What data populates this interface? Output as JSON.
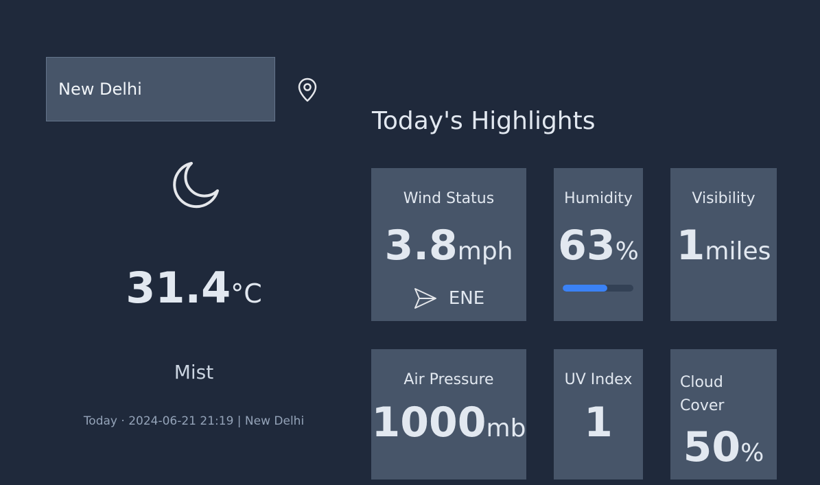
{
  "search": {
    "value": "New Delhi"
  },
  "current": {
    "icon": "moon-icon",
    "temperature": "31.4",
    "unit": "°C",
    "condition": "Mist",
    "footer": "Today · 2024-06-21 21:19 | New Delhi"
  },
  "highlights": {
    "title": "Today's Highlights",
    "wind": {
      "title": "Wind Status",
      "value": "3.8",
      "unit": "mph",
      "direction": "ENE",
      "icon": "navigation-arrow-icon"
    },
    "humidity": {
      "title": "Humidity",
      "value": "63",
      "unit": "%",
      "progress": 0.63
    },
    "visibility": {
      "title": "Visibility",
      "value": "1",
      "unit": "miles"
    },
    "pressure": {
      "title": "Air Pressure",
      "value": "1000",
      "unit": "mb"
    },
    "uv": {
      "title": "UV Index",
      "value": "1"
    },
    "cloud": {
      "title": "Cloud Cover",
      "value": "50",
      "unit": "%"
    }
  },
  "colors": {
    "background": "#1f293b",
    "card": "#475569",
    "accent": "#3b82f6"
  }
}
